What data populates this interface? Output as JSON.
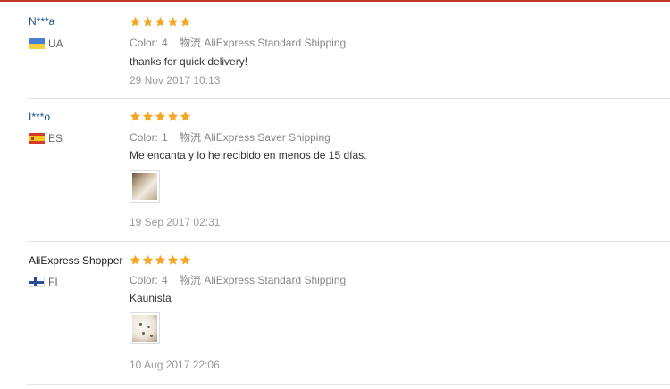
{
  "reviews": [
    {
      "user": "N***a",
      "country": "UA",
      "rating": 5,
      "color_label": "Color:",
      "color_value": "4",
      "logistics_label": "物流",
      "shipping": "AliExpress Standard Shipping",
      "text": "thanks for quick delivery!",
      "date": "29 Nov 2017 10:13"
    },
    {
      "user": "I***o",
      "country": "ES",
      "rating": 5,
      "color_label": "Color:",
      "color_value": "1",
      "logistics_label": "物流",
      "shipping": "AliExpress Saver Shipping",
      "text": "Me encanta y lo he recibido en menos de 15 días.",
      "date": "19 Sep 2017 02:31"
    },
    {
      "user": "AliExpress Shopper",
      "country": "FI",
      "rating": 5,
      "color_label": "Color:",
      "color_value": "4",
      "logistics_label": "物流",
      "shipping": "AliExpress Standard Shipping",
      "text": "Kaunista",
      "date": "10 Aug 2017 22:06"
    }
  ],
  "colors": {
    "star": "#f5a623",
    "username": "#1a4f8b",
    "accent_bar": "#c0392b"
  },
  "icons": {
    "star": "star-icon",
    "flag_ua": "flag-ua-icon",
    "flag_es": "flag-es-icon",
    "flag_fi": "flag-fi-icon"
  }
}
